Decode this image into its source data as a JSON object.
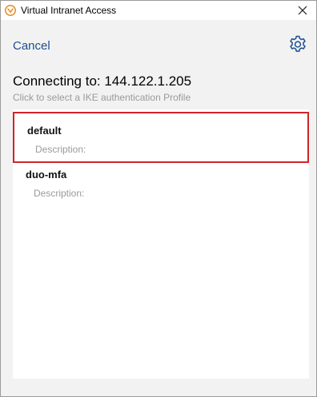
{
  "window": {
    "title": "Virtual Intranet Access",
    "app_icon": "vpn-shield-icon",
    "close_icon": "close-icon"
  },
  "header": {
    "cancel_label": "Cancel",
    "settings_icon": "gear-icon"
  },
  "connection": {
    "heading": "Connecting to: 144.122.1.205",
    "instruction": "Click to select a IKE authentication Profile"
  },
  "profiles": [
    {
      "name": "default",
      "description": "Description:",
      "selected": true
    },
    {
      "name": "duo-mfa",
      "description": "Description:",
      "selected": false
    }
  ],
  "colors": {
    "link": "#1a4f8f",
    "selection_border": "#d2232a",
    "app_icon": "#e8902a",
    "muted_text": "#9a9a9a"
  }
}
